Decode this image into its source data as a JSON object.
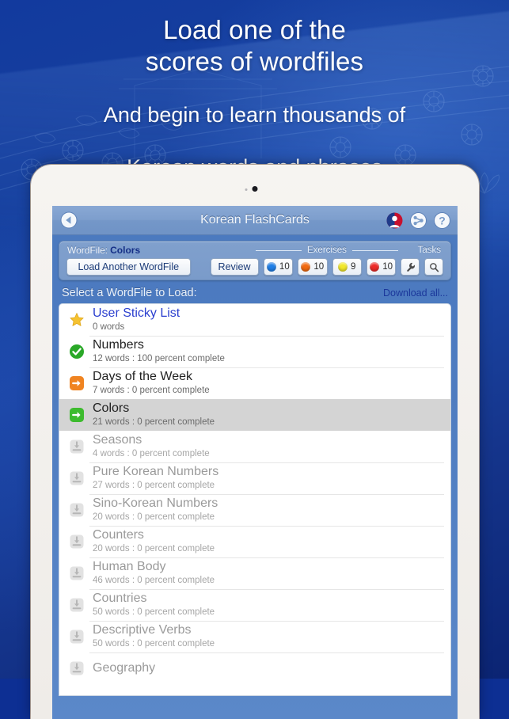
{
  "promo": {
    "line1": "Load one of the",
    "line2": "scores of wordfiles",
    "line3": "And begin to learn thousands of",
    "line4": "Korean words and phrases"
  },
  "nav": {
    "title": "Korean FlashCards",
    "back_icon": "back-circle-icon",
    "profile_icon": "profile-avatar-icon",
    "share_icon": "share-icon",
    "help_icon": "help-icon"
  },
  "toolbar": {
    "wordfile_label": "WordFile:",
    "wordfile_name": "Colors",
    "load_button": "Load Another WordFile",
    "review_button": "Review",
    "exercises_label": "Exercises",
    "tasks_label": "Tasks",
    "badges": [
      {
        "color": "#1f7fe8",
        "count": "10"
      },
      {
        "color": "#f36a10",
        "count": "10"
      },
      {
        "color": "#f2e82a",
        "count": "9"
      },
      {
        "color": "#ee2b28",
        "count": "10"
      }
    ],
    "tools": [
      {
        "icon": "wrench-icon"
      },
      {
        "icon": "magnifier-icon"
      }
    ]
  },
  "panel": {
    "title": "Select a WordFile to Load:",
    "download_all": "Download all..."
  },
  "wordfiles": [
    {
      "title": "User Sticky List",
      "subtitle": "0 words",
      "icon": "star-icon",
      "state": "sticky"
    },
    {
      "title": "Numbers",
      "subtitle": "12 words : 100 percent complete",
      "icon": "check-circle-icon",
      "state": "complete"
    },
    {
      "title": "Days of the Week",
      "subtitle": "7 words : 0 percent complete",
      "icon": "arrow-right-icon",
      "state": "loaded-orange"
    },
    {
      "title": "Colors",
      "subtitle": "21 words : 0 percent complete",
      "icon": "arrow-right-icon",
      "state": "selected"
    },
    {
      "title": "Seasons",
      "subtitle": "4 words : 0 percent complete",
      "icon": "download-icon",
      "state": "downloadable"
    },
    {
      "title": "Pure Korean Numbers",
      "subtitle": "27 words : 0 percent complete",
      "icon": "download-icon",
      "state": "downloadable"
    },
    {
      "title": "Sino-Korean Numbers",
      "subtitle": "20 words : 0 percent complete",
      "icon": "download-icon",
      "state": "downloadable"
    },
    {
      "title": "Counters",
      "subtitle": "20 words : 0 percent complete",
      "icon": "download-icon",
      "state": "downloadable"
    },
    {
      "title": "Human Body",
      "subtitle": "46 words : 0 percent complete",
      "icon": "download-icon",
      "state": "downloadable"
    },
    {
      "title": "Countries",
      "subtitle": "50 words : 0 percent complete",
      "icon": "download-icon",
      "state": "downloadable"
    },
    {
      "title": "Descriptive Verbs",
      "subtitle": "50 words : 0 percent complete",
      "icon": "download-icon",
      "state": "downloadable"
    },
    {
      "title": "Geography",
      "subtitle": "",
      "icon": "download-icon",
      "state": "downloadable"
    }
  ],
  "colors": {
    "background_blue": "#16409f",
    "nav_blue": "#7d9ecd",
    "link_blue": "#1b379b",
    "selected_row": "#d4d4d4"
  }
}
